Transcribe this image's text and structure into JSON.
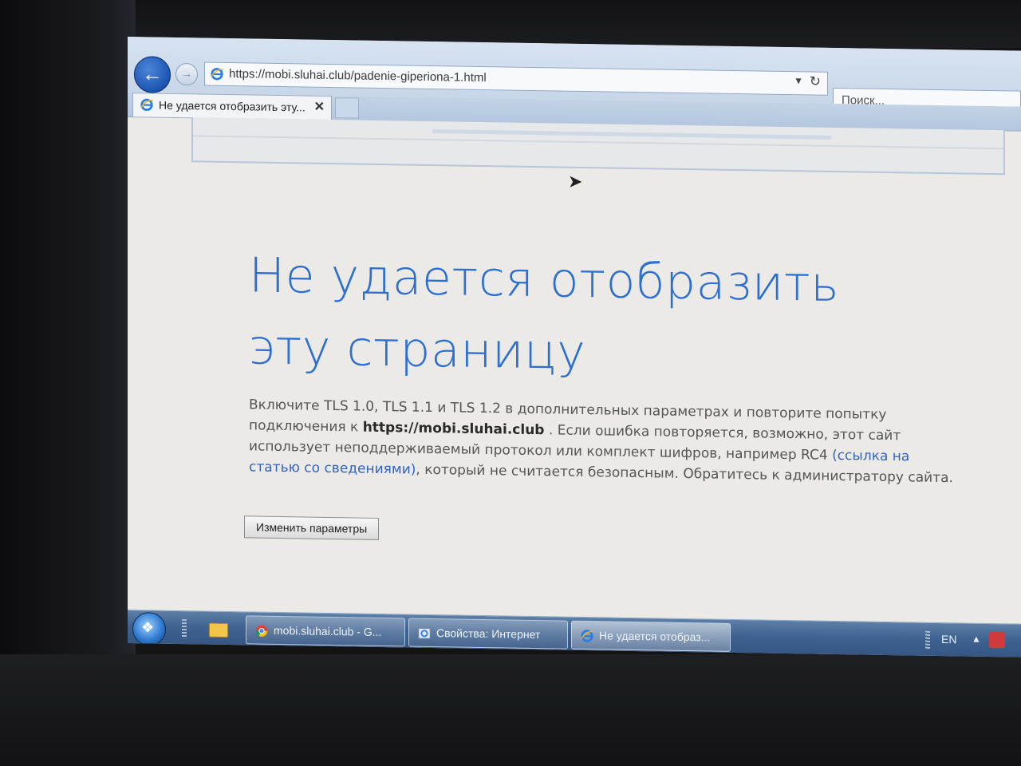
{
  "browser": {
    "url": "https://mobi.sluhai.club/padenie-giperiona-1.html",
    "search_placeholder": "Поиск...",
    "tab_title": "Не удается отобразить эту...",
    "tab_close": "✕"
  },
  "error_page": {
    "headline": "Не удается отобразить эту страницу",
    "desc_part1": "Включите TLS 1.0, TLS 1.1 и TLS 1.2 в дополнительных параметрах и повторите попытку подключения к",
    "desc_host": "https://mobi.sluhai.club",
    "desc_part2": ". Если ошибка повторяется, возможно, этот сайт использует неподдерживаемый протокол или комплект шифров, например RC4",
    "desc_link": "(ссылка на статью со сведениями)",
    "desc_part3": ", который не считается безопасным. Обратитесь к администратору сайта.",
    "button_label": "Изменить параметры"
  },
  "taskbar": {
    "tasks": [
      {
        "label": "mobi.sluhai.club - G...",
        "icon": "chrome-icon"
      },
      {
        "label": "Свойства: Интернет",
        "icon": "internet-options-icon"
      },
      {
        "label": "Не удается отобраз...",
        "icon": "ie-icon"
      }
    ],
    "language": "EN"
  },
  "colors": {
    "headline": "#2d6fd1",
    "link": "#2f63c4",
    "taskbar": "#3f6290"
  }
}
